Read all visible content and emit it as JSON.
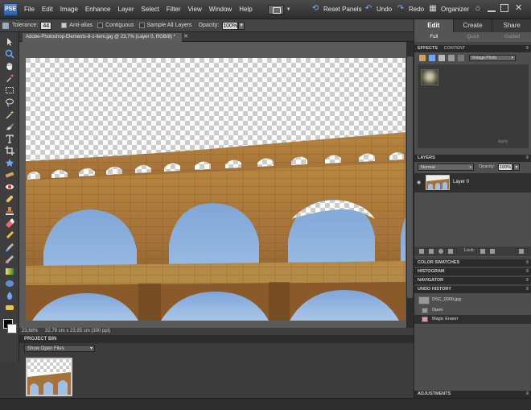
{
  "app": {
    "logo_text": "PSE",
    "menus": [
      "File",
      "Edit",
      "Image",
      "Enhance",
      "Layer",
      "Select",
      "Filter",
      "View",
      "Window",
      "Help"
    ],
    "top_buttons": {
      "reset_panels": "Reset Panels",
      "undo": "Undo",
      "redo": "Redo",
      "organizer": "Organizer"
    }
  },
  "options_bar": {
    "tolerance_label": "Tolerance:",
    "tolerance_value": "44",
    "anti_alias_label": "Anti-alias",
    "contiguous_label": "Contiguous",
    "sample_all_layers_label": "Sample All Layers",
    "opacity_label": "Opacity:",
    "opacity_value": "100%"
  },
  "document": {
    "tab_title": "Adobe-Photoshop-Elements-8-z-item.jpg @ 23,7% (Layer 0, RGB/8) *",
    "zoom": "23,68%",
    "dimensions": "32,78 cm x 23,95 cm (300 ppi)"
  },
  "project_bin": {
    "title": "PROJECT BIN",
    "dropdown": "Show Open Files"
  },
  "right_panel": {
    "mode_tabs": [
      {
        "label": "Edit",
        "active": true
      },
      {
        "label": "Create",
        "active": false
      },
      {
        "label": "Share",
        "active": false
      }
    ],
    "sub_tabs": [
      {
        "label": "Full",
        "active": true
      },
      {
        "label": "Quick",
        "active": false
      },
      {
        "label": "Guided",
        "active": false
      }
    ],
    "effects": {
      "header": "EFFECTS",
      "header2": "CONTENT",
      "filter_select": "Vintage Photo",
      "apply_label": "Apply"
    },
    "layers": {
      "header": "LAYERS",
      "blend_mode": "Normal",
      "opacity_label": "Opacity:",
      "opacity_value": "100%",
      "layer_name": "Layer 0",
      "lock_label": "Lock:"
    },
    "collapsed_panels": [
      "COLOR SWATCHES",
      "HISTOGRAM",
      "NAVIGATOR"
    ],
    "undo_history": {
      "header": "UNDO HISTORY",
      "items": [
        "DSC_0009.jpg",
        "Open",
        "Magic Eraser"
      ]
    },
    "adjustments_header": "ADJUSTMENTS"
  }
}
